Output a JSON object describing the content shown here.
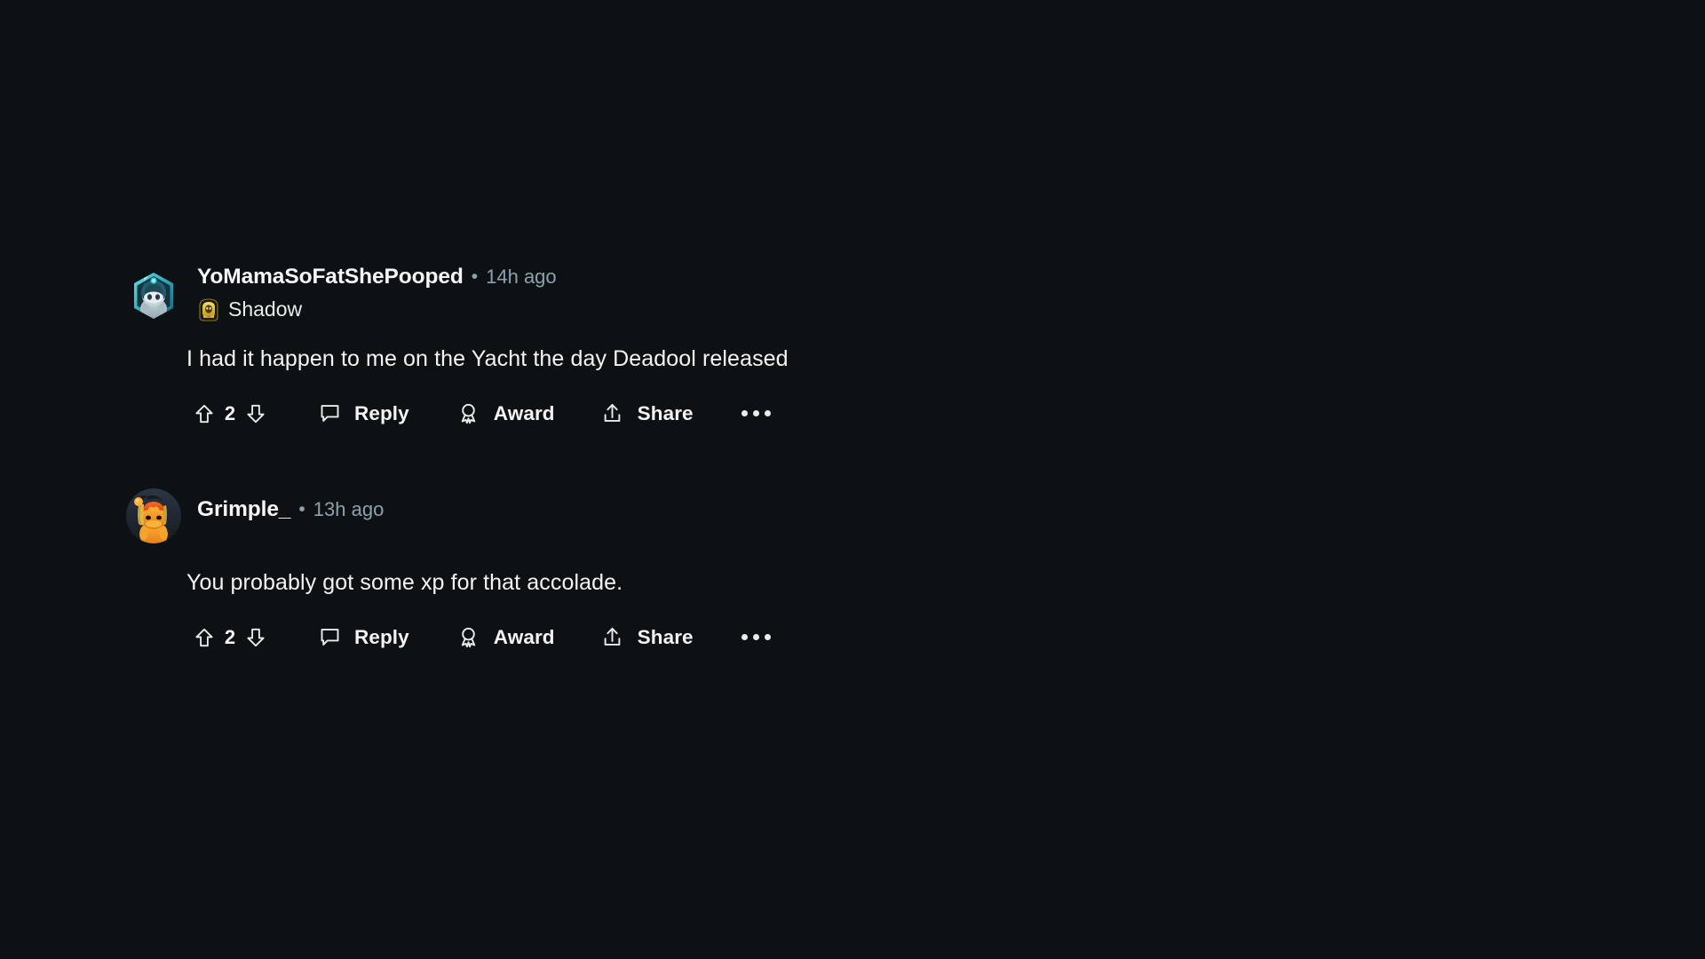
{
  "theme": {
    "background": "#0e1113",
    "text_primary": "#f2f4f5",
    "text_muted": "#8ba2ad",
    "flair_gold": "#e8c547",
    "avatar_teal": "#3ccfd4",
    "avatar_orange": "#f0821e"
  },
  "comments": [
    {
      "username": "YoMamaSoFatShePooped",
      "separator": "•",
      "timestamp": "14h ago",
      "avatar_name": "avatar-hexagon-snoo",
      "flair": {
        "icon_name": "shadow-hooded-figure-icon",
        "label": "Shadow"
      },
      "body": "I had it happen to me on the Yacht the day Deadool released",
      "actions": {
        "upvote_icon": "upvote-arrow-icon",
        "vote_count": "2",
        "downvote_icon": "downvote-arrow-icon",
        "reply_icon": "comment-bubble-icon",
        "reply_label": "Reply",
        "award_icon": "award-ribbon-icon",
        "award_label": "Award",
        "share_icon": "share-upload-icon",
        "share_label": "Share",
        "more_icon": "more-ellipsis-icon"
      }
    },
    {
      "username": "Grimple_",
      "separator": "•",
      "timestamp": "13h ago",
      "avatar_name": "avatar-circle-snoo",
      "flair": null,
      "body": "You probably got some xp for that accolade.",
      "actions": {
        "upvote_icon": "upvote-arrow-icon",
        "vote_count": "2",
        "downvote_icon": "downvote-arrow-icon",
        "reply_icon": "comment-bubble-icon",
        "reply_label": "Reply",
        "award_icon": "award-ribbon-icon",
        "award_label": "Award",
        "share_icon": "share-upload-icon",
        "share_label": "Share",
        "more_icon": "more-ellipsis-icon"
      }
    }
  ]
}
